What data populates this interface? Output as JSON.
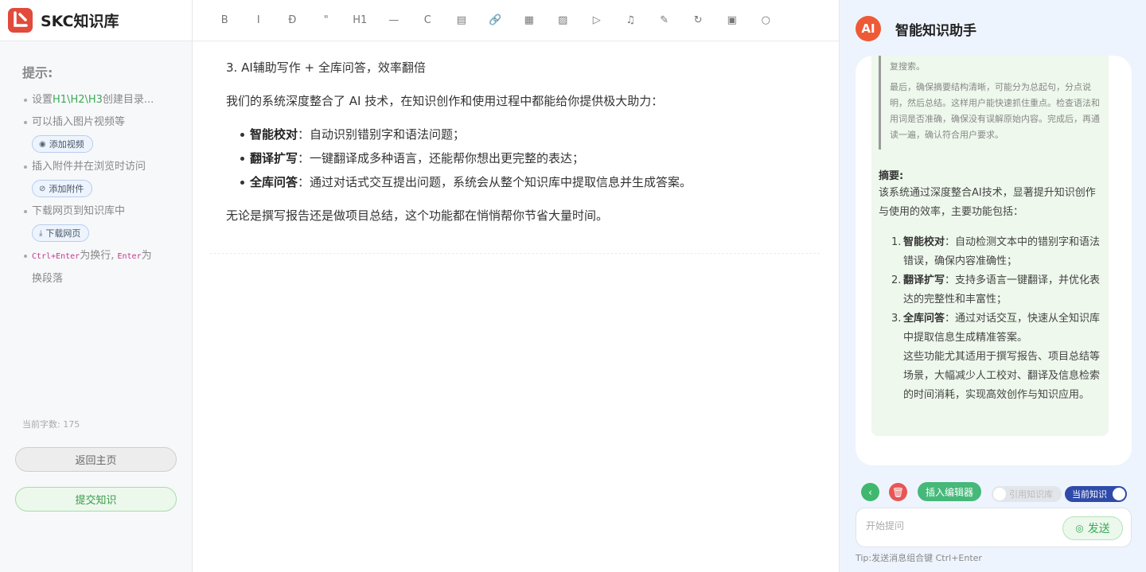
{
  "app": {
    "logo_text": "SKC知识库"
  },
  "sidebar": {
    "tips_title": "提示:",
    "tip1_prefix": "设置",
    "tip1_green": "H1\\H2\\H3",
    "tip1_suffix": "创建目录...",
    "tip2": "可以插入图片视频等",
    "add_video": "添加视频",
    "tip3": "插入附件并在浏览时访问",
    "add_attachment": "添加附件",
    "tip4": "下载网页到知识库中",
    "download_page": "下载网页",
    "tip5_code1": "Ctrl+Enter",
    "tip5_mid": "为换行,",
    "tip5_code2": "Enter",
    "tip5_end": "为",
    "tip5_second": "换段落",
    "wordcount": "当前字数: 175",
    "home_btn": "返回主页",
    "submit_btn": "提交知识"
  },
  "toolbar": {
    "bold": "B",
    "italic": "I",
    "strike": "Đ",
    "quote": "\"",
    "h1": "H1",
    "hr": "—",
    "code": "C",
    "doc": "▤",
    "link": "🔗",
    "table": "▦",
    "image": "▨",
    "video": "▷",
    "audio": "♫",
    "attach": "✎",
    "link2": "↻",
    "clipboard": "▣",
    "search": "○"
  },
  "editor": {
    "heading": "3. AI辅助写作 + 全库问答，效率翻倍",
    "intro": "我们的系统深度整合了 AI 技术，在知识创作和使用过程中都能给你提供极大助力：",
    "items": [
      {
        "bold": "智能校对",
        "text": "：自动识别错别字和语法问题；"
      },
      {
        "bold": "翻译扩写",
        "text": "：一键翻译成多种语言，还能帮你想出更完整的表达；"
      },
      {
        "bold": "全库问答",
        "text": "：通过对话式交互提出问题，系统会从整个知识库中提取信息并生成答案。"
      }
    ],
    "closing": "无论是撰写报告还是做项目总结，这个功能都在悄悄帮你节省大量时间。"
  },
  "ai": {
    "badge": "AI",
    "title": "智能知识助手",
    "quote_p1": "复搜索。",
    "quote_p2": "最后，确保摘要结构清晰，可能分为总起句，分点说明，然后总结。这样用户能快速抓住重点。检查语法和用词是否准确，确保没有误解原始内容。完成后，再通读一遍，确认符合用户要求。",
    "summary_title": "摘要:",
    "summary_text": "该系统通过深度整合AI技术，显著提升知识创作与使用的效率，主要功能包括：",
    "points": [
      {
        "num": "1.",
        "bold": "智能校对",
        "text": "：自动检测文本中的错别字和语法错误，确保内容准确性；"
      },
      {
        "num": "2.",
        "bold": "翻译扩写",
        "text": "：支持多语言一键翻译，并优化表达的完整性和丰富性；"
      },
      {
        "num": "3.",
        "bold": "全库问答",
        "text": "：通过对话交互，快速从全知识库中提取信息生成精准答案。"
      }
    ],
    "after": "这些功能尤其适用于撰写报告、项目总结等场景，大幅减少人工校对、翻译及信息检索的时间消耗，实现高效创作与知识应用。",
    "back_icon": "‹",
    "delete_icon": "🗑",
    "insert_btn": "插入编辑器",
    "toggle_library": "引用知识库",
    "toggle_current": "当前知识",
    "input_placeholder": "开始提问",
    "send_btn": "发送",
    "send_icon": "◎",
    "tip": "Tip:发送消息组合键 Ctrl+Enter"
  }
}
